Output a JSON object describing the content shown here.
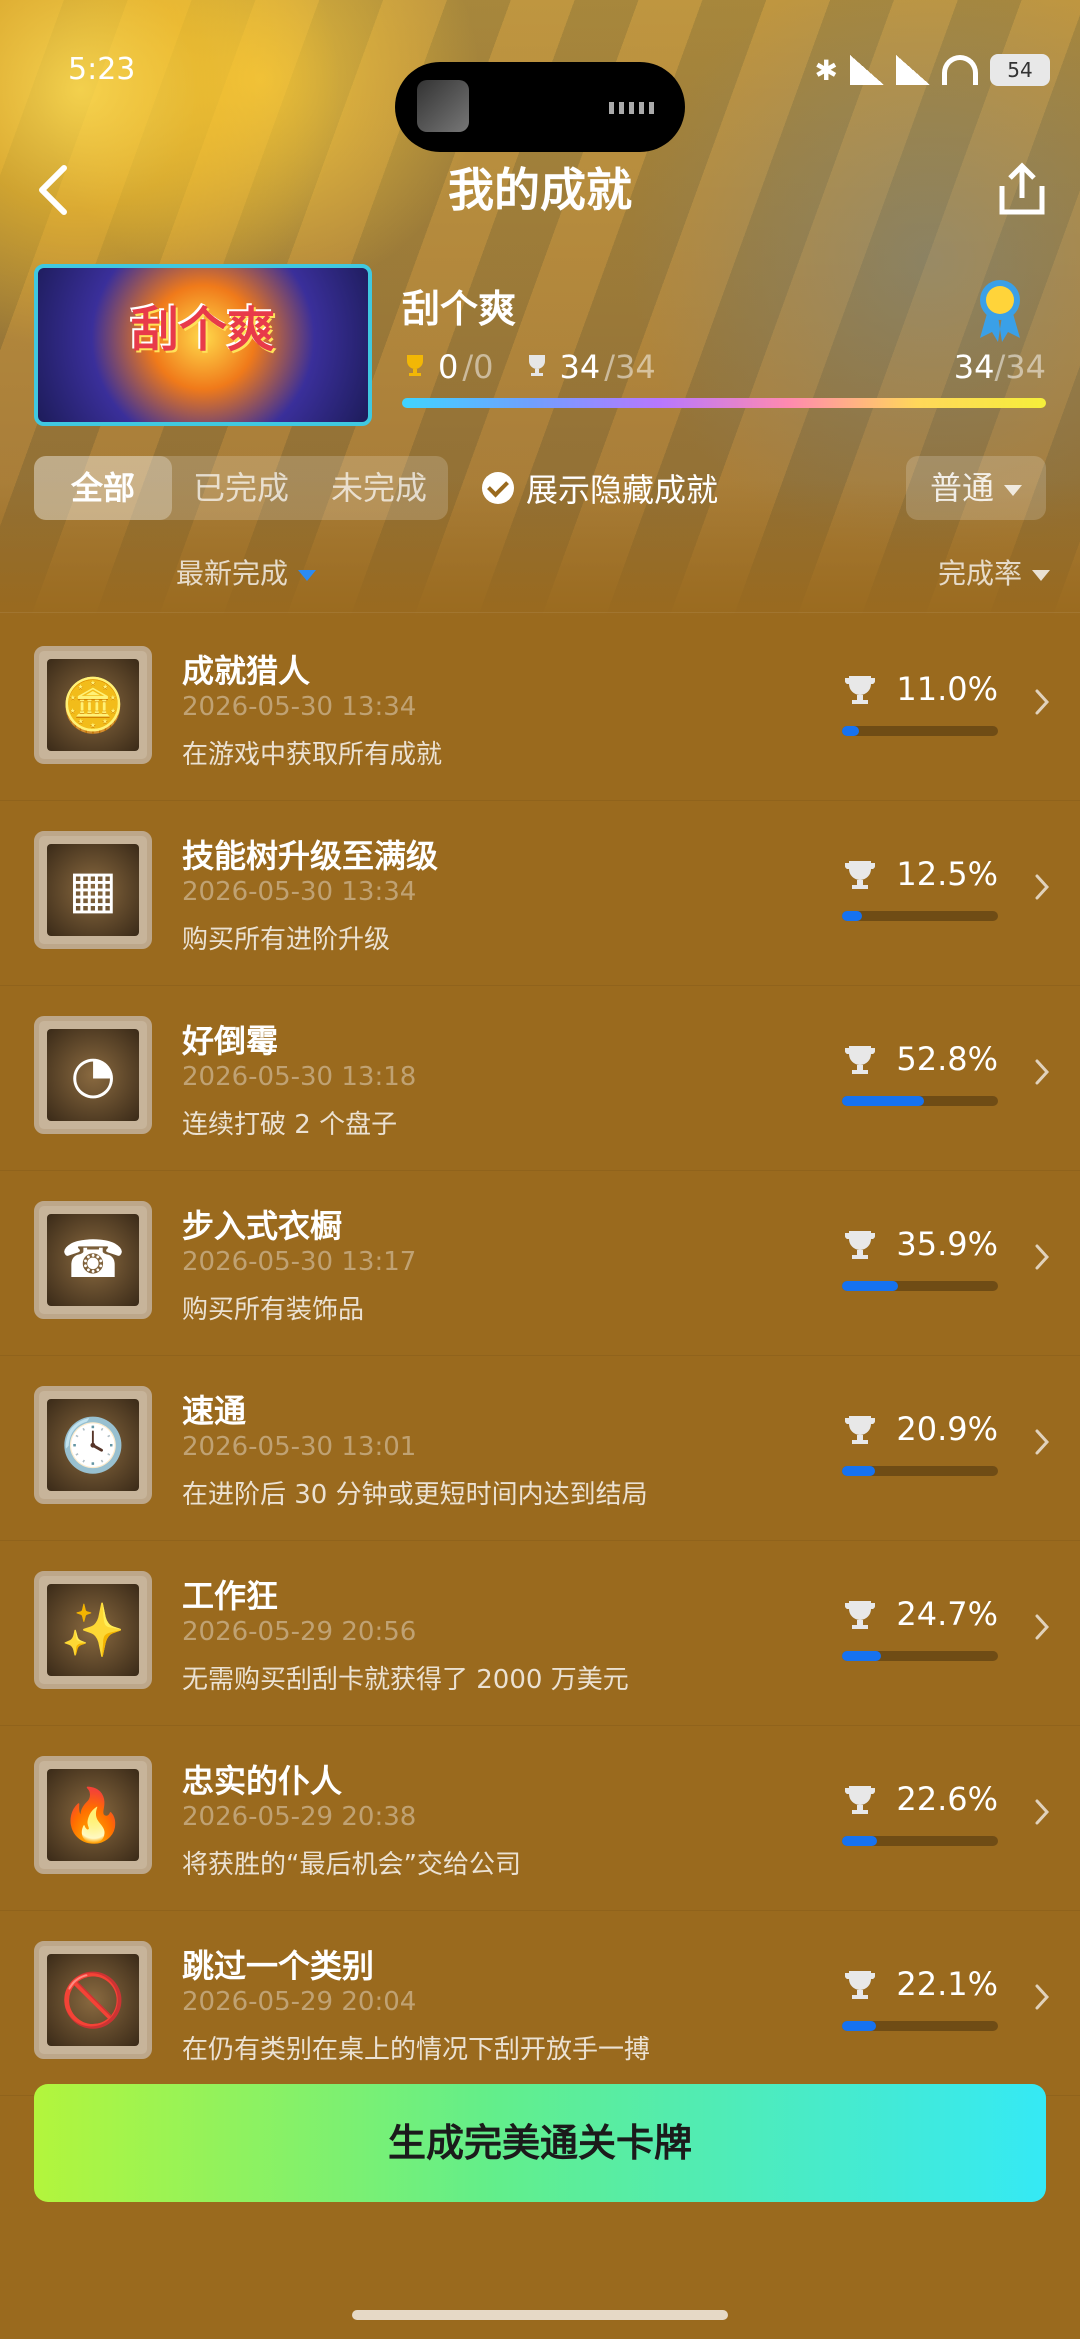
{
  "status": {
    "time": "5:23",
    "battery": "54"
  },
  "header": {
    "title": "我的成就"
  },
  "game": {
    "cover_text": "刮个爽",
    "name": "刮个爽",
    "gold_earned": "0",
    "gold_total": "/0",
    "silver_earned": "34",
    "silver_total": "/34",
    "total_earned": "34",
    "total_total": "/34"
  },
  "filters": {
    "tabs": [
      "全部",
      "已完成",
      "未完成"
    ],
    "active": 0,
    "show_hidden": "展示隐藏成就",
    "mode": "普通"
  },
  "sort": {
    "left": "最新完成",
    "right": "完成率"
  },
  "achievements": [
    {
      "name": "成就猎人",
      "date": "2026-05-30 13:34",
      "desc": "在游戏中获取所有成就",
      "percent": "11.0%",
      "progress": 0.11,
      "icon": "coin-plunger-icon"
    },
    {
      "name": "技能树升级至满级",
      "date": "2026-05-30 13:34",
      "desc": "购买所有进阶升级",
      "percent": "12.5%",
      "progress": 0.125,
      "icon": "skill-tree-icon"
    },
    {
      "name": "好倒霉",
      "date": "2026-05-30 13:18",
      "desc": "连续打破 2 个盘子",
      "percent": "52.8%",
      "progress": 0.528,
      "icon": "broken-plate-icon"
    },
    {
      "name": "步入式衣橱",
      "date": "2026-05-30 13:17",
      "desc": "购买所有装饰品",
      "percent": "35.9%",
      "progress": 0.359,
      "icon": "phone-stack-icon"
    },
    {
      "name": "速通",
      "date": "2026-05-30 13:01",
      "desc": "在进阶后 30 分钟或更短时间内达到结局",
      "percent": "20.9%",
      "progress": 0.209,
      "icon": "clock-icon"
    },
    {
      "name": "工作狂",
      "date": "2026-05-29 20:56",
      "desc": "无需购买刮刮卡就获得了 2000 万美元",
      "percent": "24.7%",
      "progress": 0.247,
      "icon": "sparkle-plate-icon"
    },
    {
      "name": "忠实的仆人",
      "date": "2026-05-29 20:38",
      "desc": "将获胜的“最后机会”交给公司",
      "percent": "22.6%",
      "progress": 0.226,
      "icon": "burning-phone-icon"
    },
    {
      "name": "跳过一个类别",
      "date": "2026-05-29 20:04",
      "desc": "在仍有类别在桌上的情况下刮开放手一搏",
      "percent": "22.1%",
      "progress": 0.221,
      "icon": "no-ticket-icon"
    }
  ],
  "cta": {
    "label": "生成完美通关卡牌"
  }
}
